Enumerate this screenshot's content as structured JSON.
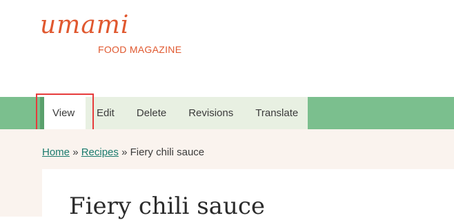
{
  "branding": {
    "logo_word": "umami",
    "tagline": "FOOD MAGAZINE",
    "color": "#e0582f"
  },
  "tabs": [
    {
      "label": "View",
      "active": true
    },
    {
      "label": "Edit",
      "active": false
    },
    {
      "label": "Delete",
      "active": false
    },
    {
      "label": "Revisions",
      "active": false
    },
    {
      "label": "Translate",
      "active": false
    }
  ],
  "breadcrumb": {
    "items": [
      {
        "label": "Home",
        "link": true
      },
      {
        "label": "Recipes",
        "link": true
      },
      {
        "label": "Fiery chili sauce",
        "link": false
      }
    ],
    "separator": "»"
  },
  "page": {
    "title": "Fiery chili sauce"
  },
  "colors": {
    "band": "#7bbf8e",
    "tabs_bg": "#e8f0e2",
    "content_bg": "#faf3ee",
    "link": "#1a7a6d",
    "highlight": "#e63b3b"
  }
}
